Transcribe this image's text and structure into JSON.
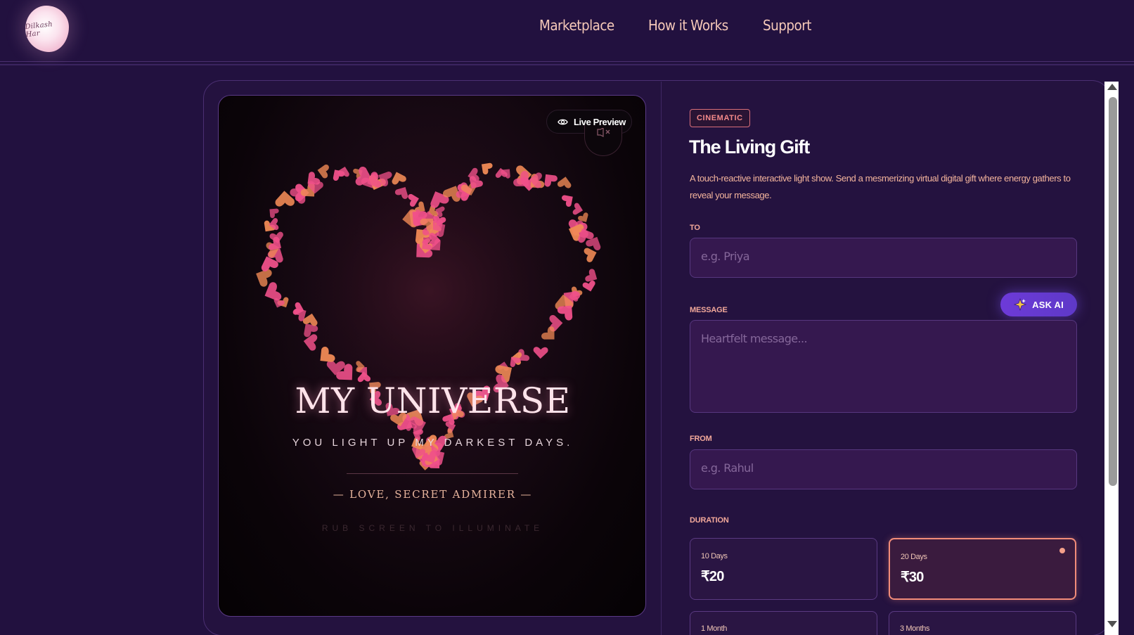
{
  "brand": {
    "logo_text": "Dilkash Har"
  },
  "nav": {
    "items": [
      "Marketplace",
      "How it Works",
      "Support"
    ]
  },
  "preview": {
    "live_label": "Live Preview",
    "title": "MY UNIVERSE",
    "subtitle": "YOU LIGHT UP MY DARKEST DAYS.",
    "signoff": "— LOVE, SECRET ADMIRER —",
    "hint": "RUB SCREEN TO ILLUMINATE",
    "icons": [
      "eye-icon",
      "mute-icon"
    ],
    "colors": {
      "heart_pink": "#f0508a",
      "heart_orange": "#f08a55",
      "glow": "#ffb4cf"
    }
  },
  "product": {
    "badge": "CINEMATIC",
    "title": "The Living Gift",
    "description": "A touch-reactive interactive light show. Send a mesmerizing virtual digital gift where energy gathers to reveal your message."
  },
  "form": {
    "to": {
      "label": "TO",
      "placeholder": "e.g. Priya"
    },
    "message": {
      "label": "MESSAGE",
      "placeholder": "Heartfelt message..."
    },
    "ask_ai": "ASK AI",
    "from": {
      "label": "FROM",
      "placeholder": "e.g. Rahul"
    },
    "duration": {
      "label": "DURATION",
      "options": [
        {
          "name": "10 Days",
          "price": "₹20",
          "selected": false
        },
        {
          "name": "20 Days",
          "price": "₹30",
          "selected": true
        },
        {
          "name": "1 Month",
          "price": "",
          "selected": false
        },
        {
          "name": "3 Months",
          "price": "",
          "selected": false
        }
      ]
    }
  },
  "theme": {
    "background": "#22113f",
    "accent": "#f28c79",
    "ai_button": "#6d3ad8"
  }
}
